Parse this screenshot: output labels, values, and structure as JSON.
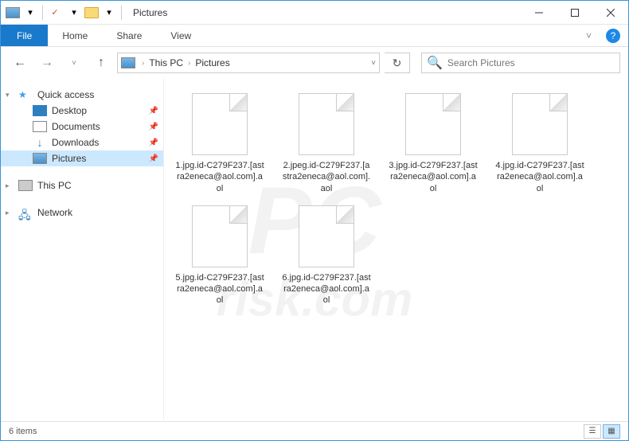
{
  "window_title": "Pictures",
  "ribbon": {
    "file": "File",
    "tabs": [
      "Home",
      "Share",
      "View"
    ]
  },
  "breadcrumbs": [
    "This PC",
    "Pictures"
  ],
  "search": {
    "placeholder": "Search Pictures"
  },
  "sidebar": {
    "quick_access": "Quick access",
    "items": [
      {
        "label": "Desktop",
        "pinned": true
      },
      {
        "label": "Documents",
        "pinned": true
      },
      {
        "label": "Downloads",
        "pinned": true
      },
      {
        "label": "Pictures",
        "pinned": true,
        "selected": true
      }
    ],
    "this_pc": "This PC",
    "network": "Network"
  },
  "files": [
    {
      "name": "1.jpg.id-C279F237.[astra2eneca@aol.com].aol"
    },
    {
      "name": "2.jpeg.id-C279F237.[astra2eneca@aol.com].aol"
    },
    {
      "name": "3.jpg.id-C279F237.[astra2eneca@aol.com].aol"
    },
    {
      "name": "4.jpg.id-C279F237.[astra2eneca@aol.com].aol"
    },
    {
      "name": "5.jpg.id-C279F237.[astra2eneca@aol.com].aol"
    },
    {
      "name": "6.jpg.id-C279F237.[astra2eneca@aol.com].aol"
    }
  ],
  "status": {
    "count_text": "6 items"
  },
  "watermark": {
    "line1": "PC",
    "line2": "risk.com"
  }
}
